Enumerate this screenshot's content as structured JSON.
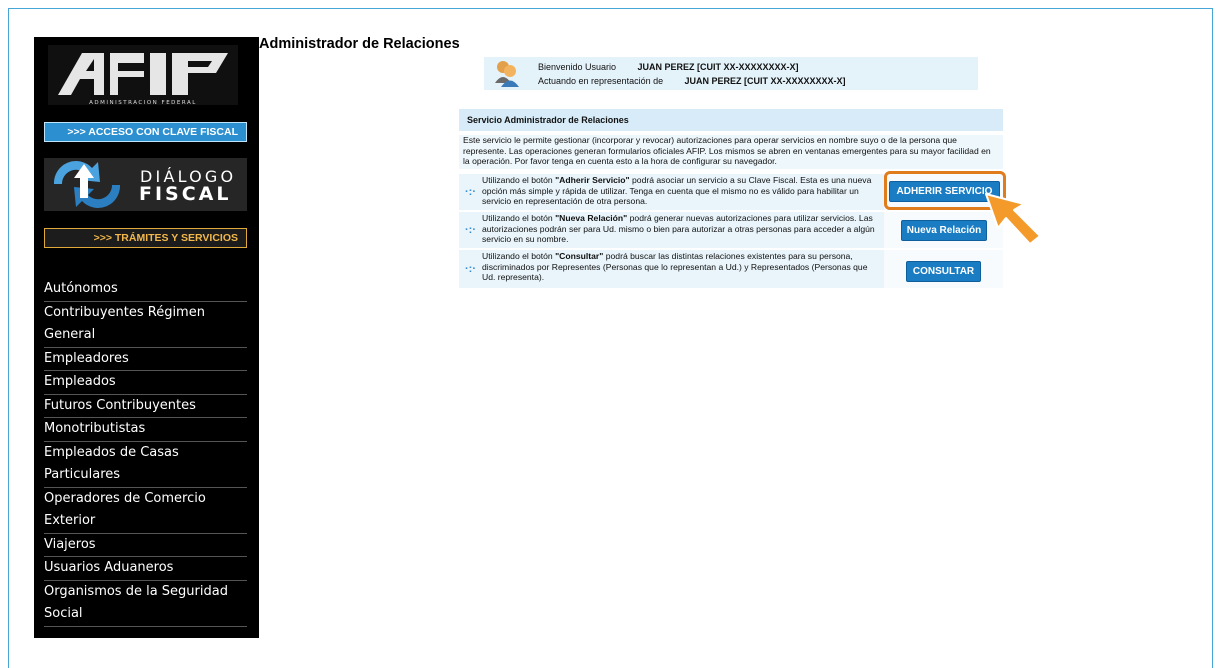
{
  "sidebar": {
    "logo_text": "ADMINISTRACION FEDERAL",
    "btn_clave": ">>> ACCESO CON CLAVE FISCAL",
    "dialogo_line1": "DIÁLOGO",
    "dialogo_line2": "FISCAL",
    "btn_tramites": ">>> TRÁMITES Y SERVICIOS",
    "items": [
      "Autónomos",
      "Contribuyentes Régimen",
      "General",
      "Empleadores",
      "Empleados",
      "Futuros Contribuyentes",
      "Monotributistas",
      "Empleados de Casas",
      "Particulares",
      "Operadores de Comercio",
      "Exterior",
      "Viajeros",
      "Usuarios Aduaneros",
      "Organismos de la Seguridad",
      "Social"
    ]
  },
  "page_title": "Administrador de Relaciones",
  "welcome": {
    "label1": "Bienvenido Usuario",
    "user": "JUAN PEREZ [CUIT XX-XXXXXXXX-X]",
    "label2": "Actuando en representación de",
    "represented": "JUAN PEREZ  [CUIT XX-XXXXXXXX-X]"
  },
  "panel": {
    "title": "Servicio Administrador de Relaciones",
    "intro": "Este servicio le permite gestionar (incorporar y revocar) autorizaciones para operar servicios en nombre suyo o de la persona que represente. Las operaciones generan formularios oficiales AFIP. Los mismos se abren en ventanas emergentes para su mayor facilidad en la operación. Por favor tenga en cuenta esto a la hora de configurar su navegador.",
    "services": [
      {
        "pre": "Utilizando el botón ",
        "bold": "\"Adherir Servicio\"",
        "post": " podrá asociar un servicio a su Clave Fiscal. Esta es una nueva opción más simple y rápida de utilizar. Tenga en cuenta que el mismo no es válido para habilitar un servicio en representación de otra persona.",
        "button": "ADHERIR SERVICIO"
      },
      {
        "pre": "Utilizando el botón ",
        "bold": "\"Nueva Relación\"",
        "post": " podrá generar nuevas autorizaciones para utilizar servicios. Las autorizaciones podrán ser para Ud. mismo o bien para autorizar a otras personas para acceder a algún servicio en su nombre.",
        "button": "Nueva Relación"
      },
      {
        "pre": "Utilizando el botón ",
        "bold": "\"Consultar\"",
        "post": " podrá buscar las distintas relaciones existentes para su persona, discriminados por Representes (Personas que lo representan a Ud.) y Representados (Personas que Ud. representa).",
        "button": "CONSULTAR"
      }
    ]
  },
  "colors": {
    "accent_blue": "#1a7dc4",
    "highlight_orange": "#e07c1c",
    "sidebar_bg": "#000000"
  },
  "icons": {
    "avatar": "users-icon",
    "bullet": "crosshair-dot-icon",
    "pointer": "arrow-cursor-icon"
  }
}
